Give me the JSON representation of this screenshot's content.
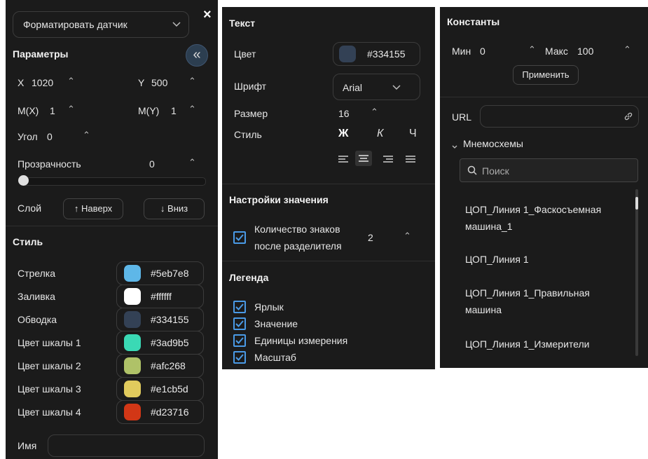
{
  "panel1": {
    "format_select": "Форматировать датчик",
    "close": "×",
    "params_title": "Параметры",
    "collapse": "«",
    "x_label": "X",
    "x_value": "1020",
    "y_label": "Y",
    "y_value": "500",
    "mx_label": "M(X)",
    "mx_value": "1",
    "my_label": "M(Y)",
    "my_value": "1",
    "angle_label": "Угол",
    "angle_value": "0",
    "opacity_label": "Прозрачность",
    "opacity_value": "0",
    "layer_label": "Слой",
    "up_button": "↑ Наверх",
    "down_button": "↓ Вниз",
    "style_title": "Стиль",
    "colors": [
      {
        "label": "Стрелка",
        "hex": "#5eb7e8",
        "color": "#5eb7e8"
      },
      {
        "label": "Заливка",
        "hex": "#ffffff",
        "color": "#ffffff"
      },
      {
        "label": "Обводка",
        "hex": "#334155",
        "color": "#334155"
      },
      {
        "label": "Цвет шкалы 1",
        "hex": "#3ad9b5",
        "color": "#3ad9b5"
      },
      {
        "label": "Цвет шкалы 2",
        "hex": "#afc268",
        "color": "#afc268"
      },
      {
        "label": "Цвет шкалы 3",
        "hex": "#e1cb5d",
        "color": "#e1cb5d"
      },
      {
        "label": "Цвет шкалы 4",
        "hex": "#d23716",
        "color": "#d23716"
      }
    ],
    "name_label": "Имя"
  },
  "panel2": {
    "text_title": "Текст",
    "color_label": "Цвет",
    "color_hex": "#334155",
    "color_value": "#334155",
    "font_label": "Шрифт",
    "font_value": "Arial",
    "size_label": "Размер",
    "size_value": "16",
    "style_label": "Стиль",
    "bold": "Ж",
    "italic": "К",
    "underline": "Ч",
    "value_settings_title": "Настройки значения",
    "decimals_label_1": "Количество знаков",
    "decimals_label_2": "после разделителя",
    "decimals_value": "2",
    "legend_title": "Легенда",
    "legend_items": [
      "Ярлык",
      "Значение",
      "Единицы измерения",
      "Масштаб"
    ]
  },
  "panel3": {
    "constants_title": "Константы",
    "min_label": "Мин",
    "min_value": "0",
    "max_label": "Макс",
    "max_value": "100",
    "apply_button": "Применить",
    "url_label": "URL",
    "mnemo_title": "Мнемосхемы",
    "search_placeholder": "Поиск",
    "items": [
      {
        "line1": "ЦОП_Линия 1_Фаскосъемная",
        "line2": "машина_1"
      },
      {
        "line1": "ЦОП_Линия 1",
        "line2": ""
      },
      {
        "line1": "ЦОП_Линия 1_Правильная",
        "line2": "машина"
      },
      {
        "line1": "ЦОП_Линия 1_Измерители",
        "line2": ""
      }
    ]
  }
}
